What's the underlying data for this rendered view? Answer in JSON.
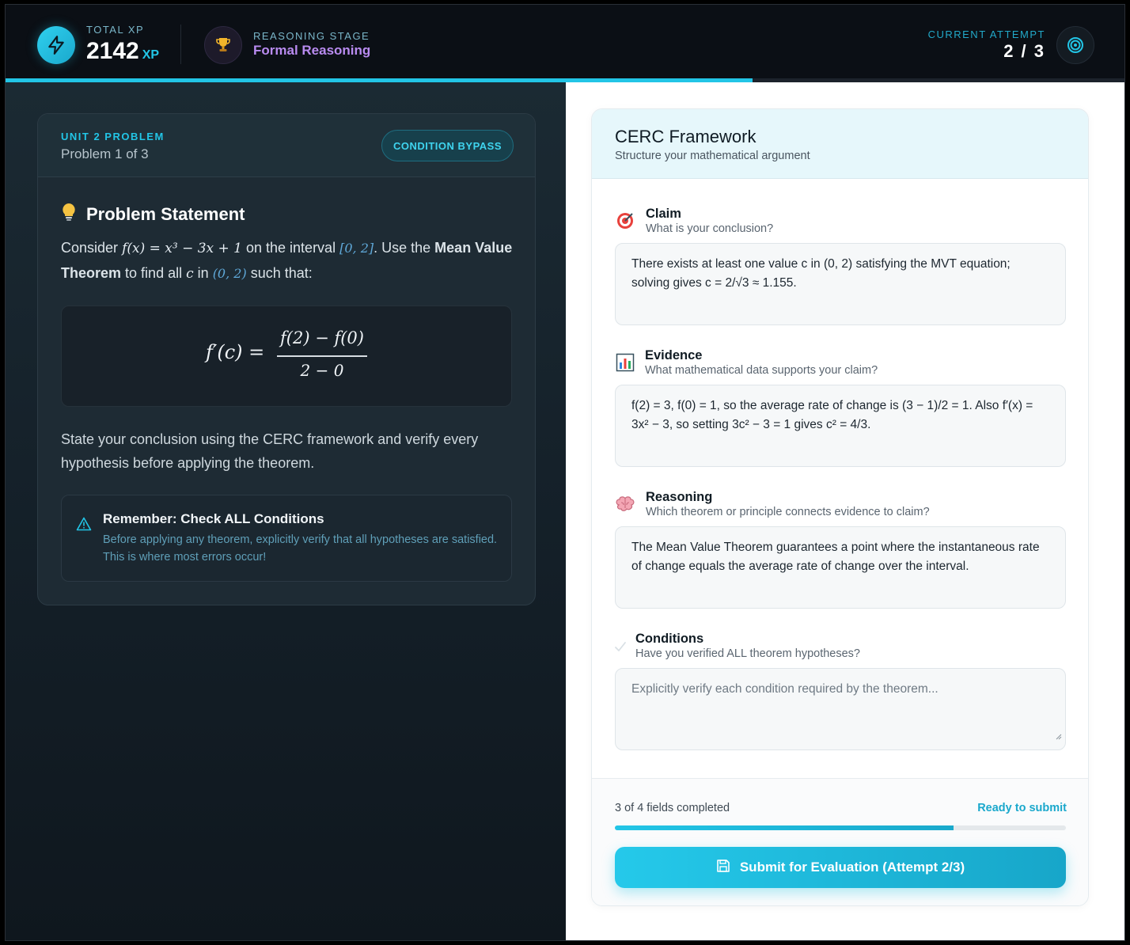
{
  "header": {
    "xp_label": "TOTAL XP",
    "xp_value": "2142",
    "xp_unit": "XP",
    "stage_label": "REASONING STAGE",
    "stage_value": "Formal Reasoning",
    "attempt_label": "CURRENT ATTEMPT",
    "attempt_value": "2 / 3",
    "progress_fraction": 0.667
  },
  "problem": {
    "unit_label": "UNIT 2 PROBLEM",
    "unit_sub": "Problem 1 of 3",
    "bypass_label": "CONDITION BYPASS",
    "title": "Problem Statement",
    "text_1": "Consider",
    "func": "f(x) = x³ − 3x + 1",
    "text_2": "on the interval",
    "interval": "[0, 2]",
    "text_3": ". Use the",
    "theorem": "Mean Value Theorem",
    "text_4": "to find all",
    "var_c": "c",
    "text_5": "in",
    "open_interval": "(0, 2)",
    "text_6": "such that:",
    "formula_lhs": "f′(c)  =",
    "formula_num": "f(2) − f(0)",
    "formula_den": "2 − 0",
    "note": "State your conclusion using the CERC framework and verify every hypothesis before applying the theorem.",
    "remember_title": "Remember: Check ALL Conditions",
    "remember_text": "Before applying any theorem, explicitly verify that all hypotheses are satisfied. This is where most errors occur!"
  },
  "cerc": {
    "title": "CERC Framework",
    "subtitle": "Structure your mathematical argument",
    "fields": [
      {
        "label": "Claim",
        "question": "What is your conclusion?",
        "value": "There exists at least one value c in (0, 2) satisfying the MVT equation; solving gives c = 2/√3 ≈ 1.155.",
        "placeholder": ""
      },
      {
        "label": "Evidence",
        "question": "What mathematical data supports your claim?",
        "value": "f(2) = 3, f(0) = 1, so the average rate of change is (3 − 1)/2 = 1. Also f′(x) = 3x² − 3, so setting 3c² − 3 = 1 gives c² = 4/3.",
        "placeholder": ""
      },
      {
        "label": "Reasoning",
        "question": "Which theorem or principle connects evidence to claim?",
        "value": "The Mean Value Theorem guarantees a point where the instantaneous rate of change equals the average rate of change over the interval.",
        "placeholder": ""
      },
      {
        "label": "Conditions",
        "question": "Have you verified ALL theorem hypotheses?",
        "value": "",
        "placeholder": "Explicitly verify each condition required by the theorem..."
      }
    ],
    "fields_count": "3 of 4 fields completed",
    "ready_text": "Ready to submit",
    "completion_fraction": 0.75,
    "submit_label": "Submit for Evaluation (Attempt 2/3)"
  },
  "colors": {
    "accent": "#22c5e6",
    "stage": "#b98bf0",
    "dark_bg": "#0b0f14"
  },
  "icons": {
    "xp": "lightning-icon",
    "stage": "trophy-icon",
    "attempt": "target-icon",
    "problem": "lightbulb-icon",
    "warning": "warning-triangle-icon",
    "claim": "bullseye-icon",
    "evidence": "bar-chart-icon",
    "reasoning": "brain-icon",
    "conditions": "check-icon",
    "submit": "save-icon"
  }
}
